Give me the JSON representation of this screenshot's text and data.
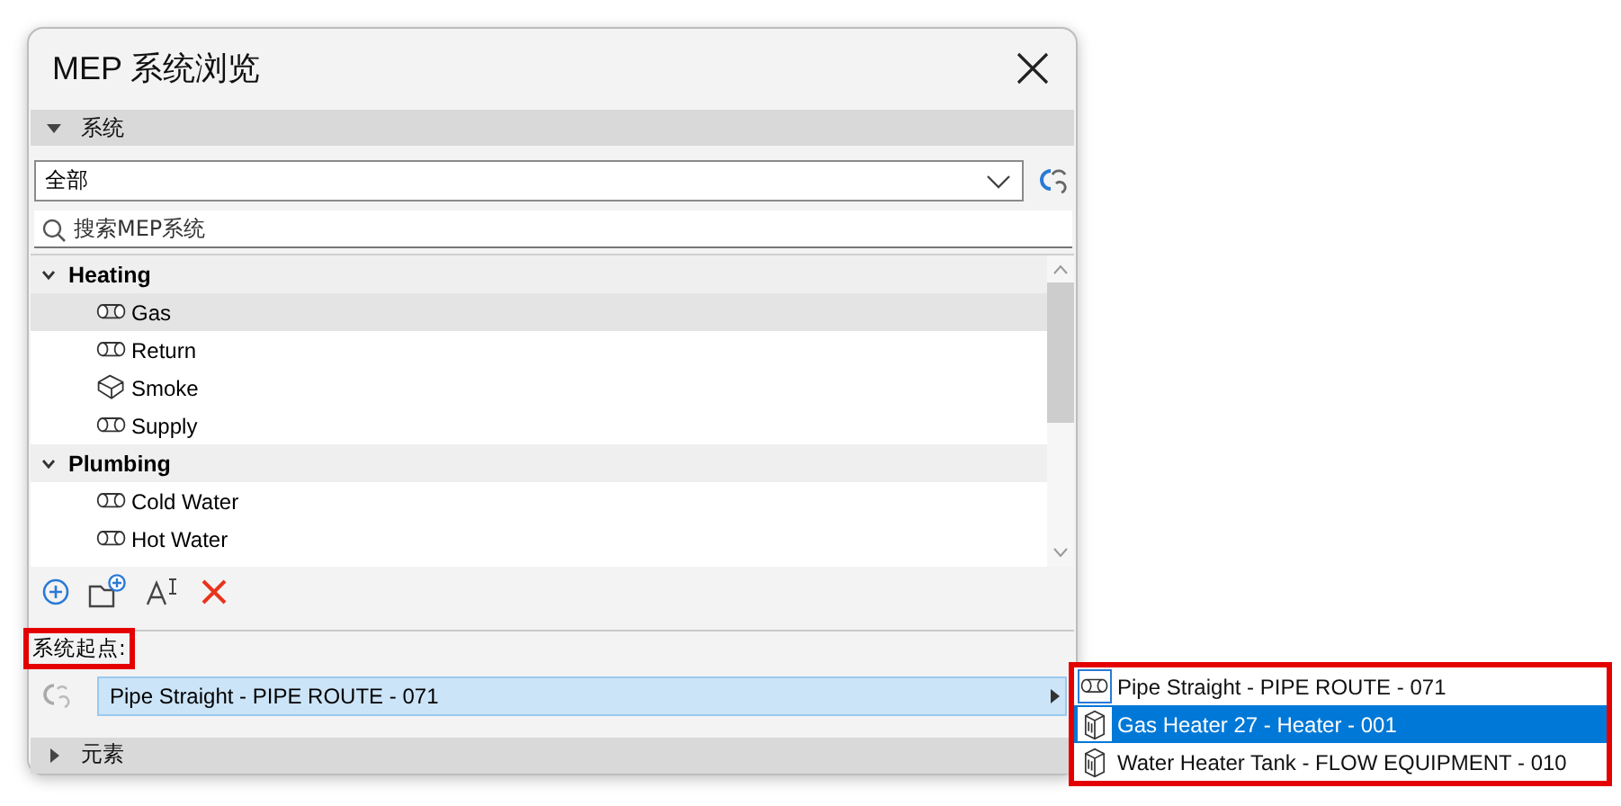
{
  "window": {
    "title": "MEP 系统浏览"
  },
  "systems_section": {
    "label": "系统",
    "expanded": true
  },
  "filter": {
    "value": "全部"
  },
  "search": {
    "placeholder": "搜索MEP系统"
  },
  "tree": [
    {
      "label": "Heating",
      "expanded": true,
      "children": [
        {
          "label": "Gas",
          "kind": "pipe",
          "selected": true
        },
        {
          "label": "Return",
          "kind": "pipe",
          "selected": false
        },
        {
          "label": "Smoke",
          "kind": "duct",
          "selected": false
        },
        {
          "label": "Supply",
          "kind": "pipe",
          "selected": false
        }
      ]
    },
    {
      "label": "Plumbing",
      "expanded": true,
      "children": [
        {
          "label": "Cold Water",
          "kind": "pipe",
          "selected": false
        },
        {
          "label": "Hot Water",
          "kind": "pipe",
          "selected": false
        }
      ]
    }
  ],
  "origin": {
    "label": "系统起点:",
    "highlighted": true,
    "value": "Pipe Straight - PIPE ROUTE - 071"
  },
  "elements_section": {
    "label": "元素",
    "expanded": false
  },
  "popup": {
    "highlighted": true,
    "items": [
      {
        "label": "Pipe Straight - PIPE ROUTE - 071",
        "kind": "pipe",
        "selected": false
      },
      {
        "label": "Gas Heater 27 - Heater - 001",
        "kind": "equipment",
        "selected": true
      },
      {
        "label": "Water Heater Tank - FLOW EQUIPMENT - 010",
        "kind": "equipment",
        "selected": false
      }
    ]
  }
}
